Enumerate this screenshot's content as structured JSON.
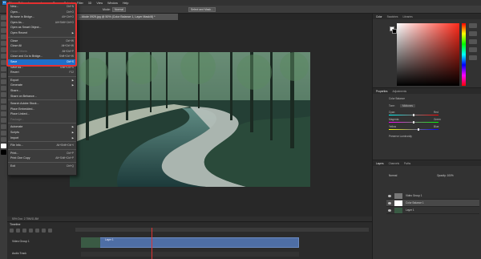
{
  "menubar": {
    "items": [
      "File",
      "Edit",
      "Image",
      "Layer",
      "Type",
      "Select",
      "Filter",
      "3D",
      "View",
      "Window",
      "Help"
    ]
  },
  "optionsbar": {
    "mode_label": "Mode:",
    "mode_value": "Normal",
    "select_mask": "Select and Mask..."
  },
  "document": {
    "tab_title": "...Mode 0929.jpg @ 50% (Color Balance 1, Layer Mask/8) *"
  },
  "statusbar": {
    "text": "50%    Doc: 2.75M/11.8M"
  },
  "timeline": {
    "title": "Timeline",
    "track": "Video Group 1",
    "audio_track": "Audio Track",
    "clip_label": "Layer 1"
  },
  "panels": {
    "color_tabs": [
      "Color",
      "Swatches",
      "Libraries"
    ],
    "properties_tabs": [
      "Properties",
      "Adjustments"
    ],
    "layers_tabs": [
      "Layers",
      "Channels",
      "Paths"
    ]
  },
  "properties": {
    "title": "Color Balance",
    "tone_label": "Tone:",
    "tone_value": "Midtones",
    "cyan": "Cyan",
    "red": "Red",
    "magenta": "Magenta",
    "green": "Green",
    "yellow": "Yellow",
    "blue": "Blue",
    "preserve": "Preserve Luminosity"
  },
  "layers": {
    "blend": "Normal",
    "opacity": "Opacity: 100%",
    "items": [
      "Video Group 1",
      "Color Balance 1",
      "Layer 1"
    ]
  },
  "file_menu": {
    "items": [
      {
        "label": "New...",
        "shortcut": "Ctrl+N"
      },
      {
        "label": "Open...",
        "shortcut": "Ctrl+O"
      },
      {
        "label": "Browse in Bridge...",
        "shortcut": "Alt+Ctrl+O"
      },
      {
        "label": "Open As...",
        "shortcut": "Alt+Shift+Ctrl+O"
      },
      {
        "label": "Open as Smart Object...",
        "shortcut": ""
      },
      {
        "label": "Open Recent",
        "shortcut": ""
      },
      {
        "label": "Close",
        "shortcut": "Ctrl+W"
      },
      {
        "label": "Close All",
        "shortcut": "Alt+Ctrl+W"
      },
      {
        "label": "Close Others",
        "shortcut": "Alt+Ctrl+P"
      },
      {
        "label": "Close and Go to Bridge...",
        "shortcut": "Shift+Ctrl+W"
      },
      {
        "label": "Save",
        "shortcut": "Ctrl+S"
      },
      {
        "label": "Save As...",
        "shortcut": "Shift+Ctrl+S"
      },
      {
        "label": "Revert",
        "shortcut": "F12"
      },
      {
        "label": "Export",
        "shortcut": ""
      },
      {
        "label": "Generate",
        "shortcut": ""
      },
      {
        "label": "Share...",
        "shortcut": ""
      },
      {
        "label": "Share on Behance...",
        "shortcut": ""
      },
      {
        "label": "Search Adobe Stock...",
        "shortcut": ""
      },
      {
        "label": "Place Embedded...",
        "shortcut": ""
      },
      {
        "label": "Place Linked...",
        "shortcut": ""
      },
      {
        "label": "Package...",
        "shortcut": ""
      },
      {
        "label": "Automate",
        "shortcut": ""
      },
      {
        "label": "Scripts",
        "shortcut": ""
      },
      {
        "label": "Import",
        "shortcut": ""
      },
      {
        "label": "File Info...",
        "shortcut": "Alt+Shift+Ctrl+I"
      },
      {
        "label": "Print...",
        "shortcut": "Ctrl+P"
      },
      {
        "label": "Print One Copy",
        "shortcut": "Alt+Shift+Ctrl+P"
      },
      {
        "label": "Exit",
        "shortcut": "Ctrl+Q"
      }
    ]
  }
}
